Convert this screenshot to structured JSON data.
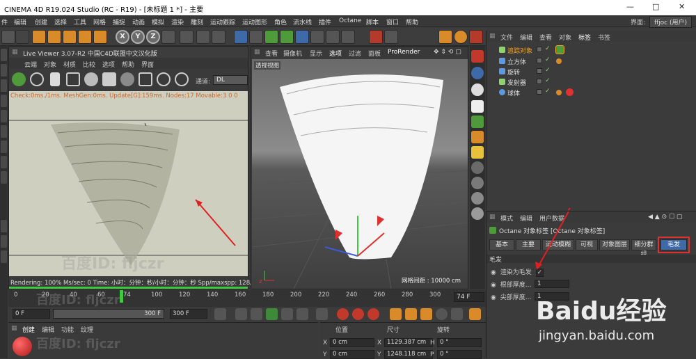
{
  "window": {
    "title": "CINEMA 4D R19.024 Studio (RC - R19) - [未标题 1 *] - 主要",
    "minimize": "—",
    "maximize": "□",
    "close": "✕"
  },
  "menubar": {
    "items": [
      "件",
      "编辑",
      "创建",
      "选择",
      "工具",
      "网格",
      "捕捉",
      "动画",
      "模拟",
      "渲染",
      "雕刻",
      "运动跟踪",
      "运动图形",
      "角色",
      "流水线",
      "插件",
      "Octane",
      "脚本",
      "窗口",
      "帮助"
    ],
    "interface_label": "界面:",
    "interface_value": "ffjoc (用户)"
  },
  "toolbar": {
    "icons": [
      "undo-icon",
      "redo-icon",
      "select-icon",
      "move-icon",
      "scale-icon",
      "rotate-icon",
      "add-icon",
      "x-axis-icon",
      "y-axis-icon",
      "z-axis-icon",
      "coord-icon",
      "render-region-icon",
      "render-view-icon",
      "render-settings-icon",
      "cube-icon",
      "pen-icon",
      "subdivision-icon",
      "array-icon",
      "deformer-icon",
      "floor-icon",
      "camera-icon",
      "light-icon",
      "octane-icon",
      "tags-icon",
      "close-icon"
    ],
    "axis_labels": [
      "X",
      "Y",
      "Z"
    ]
  },
  "live_viewer": {
    "title": "Live Viewer 3.07-R2 中国C4D联盟中文汉化版",
    "menu": [
      "云端",
      "对象",
      "材质",
      "比较",
      "选项",
      "帮助",
      "界面"
    ],
    "channel_label": "通道:",
    "channel_value": "DL",
    "check_line": "Check:0ms./1ms. MeshGen:0ms. Update[G]:159ms. Nodes:17 Movable:3  0 0",
    "status_line": "Rendering: 100%   Ms/sec: 0   Time: 小时：分钟：秒/小时：分钟：秒   Spp/maxspp: 128/128",
    "progress": 100,
    "watermark": "百度ID: fljczr"
  },
  "viewport": {
    "menu": [
      "查看",
      "摄像机",
      "显示",
      "选项",
      "过滤",
      "面板",
      "ProRender"
    ],
    "label": "透视视图",
    "grid_distance": "网格间距 : 10000 cm"
  },
  "object_manager": {
    "menu": [
      "文件",
      "编辑",
      "查看",
      "对象",
      "标签",
      "书签"
    ],
    "objects": [
      {
        "name": "追踪对象",
        "selected": true,
        "icon_color": "#8fd36c",
        "tag_color": "#4f9a3a"
      },
      {
        "name": "立方体",
        "selected": false,
        "icon_color": "#5d9be0",
        "tag_color": "#d98b2a"
      },
      {
        "name": "旋转",
        "selected": false,
        "icon_color": "#5d9be0",
        "tag_color": ""
      },
      {
        "name": "发射器",
        "selected": false,
        "icon_color": "#8fd36c",
        "tag_color": ""
      },
      {
        "name": "球体",
        "selected": false,
        "icon_color": "#5d9be0",
        "tag_color": "#e03030"
      }
    ]
  },
  "attribute_manager": {
    "menu": [
      "模式",
      "编辑",
      "用户数据"
    ],
    "header": "Octane 对象标签 [Octane 对象标签]",
    "tabs": [
      "基本",
      "主要",
      "运动模糊",
      "可视",
      "对象图层",
      "细分群组",
      "毛发"
    ],
    "active_tab": "毛发",
    "section": "毛发",
    "rows": [
      {
        "label": "渲染为毛发",
        "value": "✓"
      },
      {
        "label": "根部厚度...",
        "value": "1"
      },
      {
        "label": "尖部厚度...",
        "value": "1"
      }
    ]
  },
  "timeline": {
    "ticks": [
      "0",
      "20",
      "40",
      "60",
      "74",
      "100",
      "120",
      "140",
      "160",
      "180",
      "200",
      "220",
      "240",
      "260",
      "280",
      "300"
    ],
    "current_frame": "74 F",
    "watermark": "百度ID: fljczr"
  },
  "transport": {
    "start": "0 F",
    "range_mid": "300 F",
    "end": "300 F"
  },
  "material_manager": {
    "menu": [
      "创建",
      "编辑",
      "功能",
      "纹理"
    ],
    "watermark": "百度ID: fljczr"
  },
  "coord_manager": {
    "headers": [
      "位置",
      "尺寸",
      "旋转"
    ],
    "rows": [
      {
        "axis": "X",
        "pos": "0 cm",
        "size_axis": "X",
        "size": "1129.387 cm",
        "rot_axis": "H",
        "rot": "0 °"
      },
      {
        "axis": "Y",
        "pos": "0 cm",
        "size_axis": "Y",
        "size": "1248.118 cm",
        "rot_axis": "P",
        "rot": "0 °"
      }
    ]
  },
  "baidu": {
    "logo": "Baidu经验",
    "url": "jingyan.baidu.com"
  }
}
